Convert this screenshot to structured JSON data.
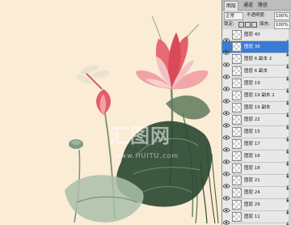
{
  "watermark": {
    "main": "汇图网",
    "sub": "www.HUITU.com"
  },
  "panel": {
    "tabs": [
      "图层",
      "通道",
      "路径"
    ],
    "blend_mode": "正常",
    "opacity_label": "不透明度:",
    "opacity_value": "100%",
    "lock_label": "锁定:",
    "fill_label": "填充:",
    "fill_value": "100%",
    "layers": [
      {
        "name": "图层 40",
        "active": false
      },
      {
        "name": "图层 36",
        "active": true
      },
      {
        "name": "图层 6 副本 2",
        "active": false
      },
      {
        "name": "图层 6 副本",
        "active": false
      },
      {
        "name": "图层 19",
        "active": false
      },
      {
        "name": "图层 19 副本 2",
        "active": false
      },
      {
        "name": "图层 19 副本",
        "active": false
      },
      {
        "name": "图层 22",
        "active": false
      },
      {
        "name": "图层 15",
        "active": false
      },
      {
        "name": "图层 17",
        "active": false
      },
      {
        "name": "图层 16",
        "active": false
      },
      {
        "name": "图层 18",
        "active": false
      },
      {
        "name": "图层 21",
        "active": false
      },
      {
        "name": "图层 24",
        "active": false
      },
      {
        "name": "图层 29",
        "active": false
      },
      {
        "name": "图层 11",
        "active": false
      }
    ]
  }
}
